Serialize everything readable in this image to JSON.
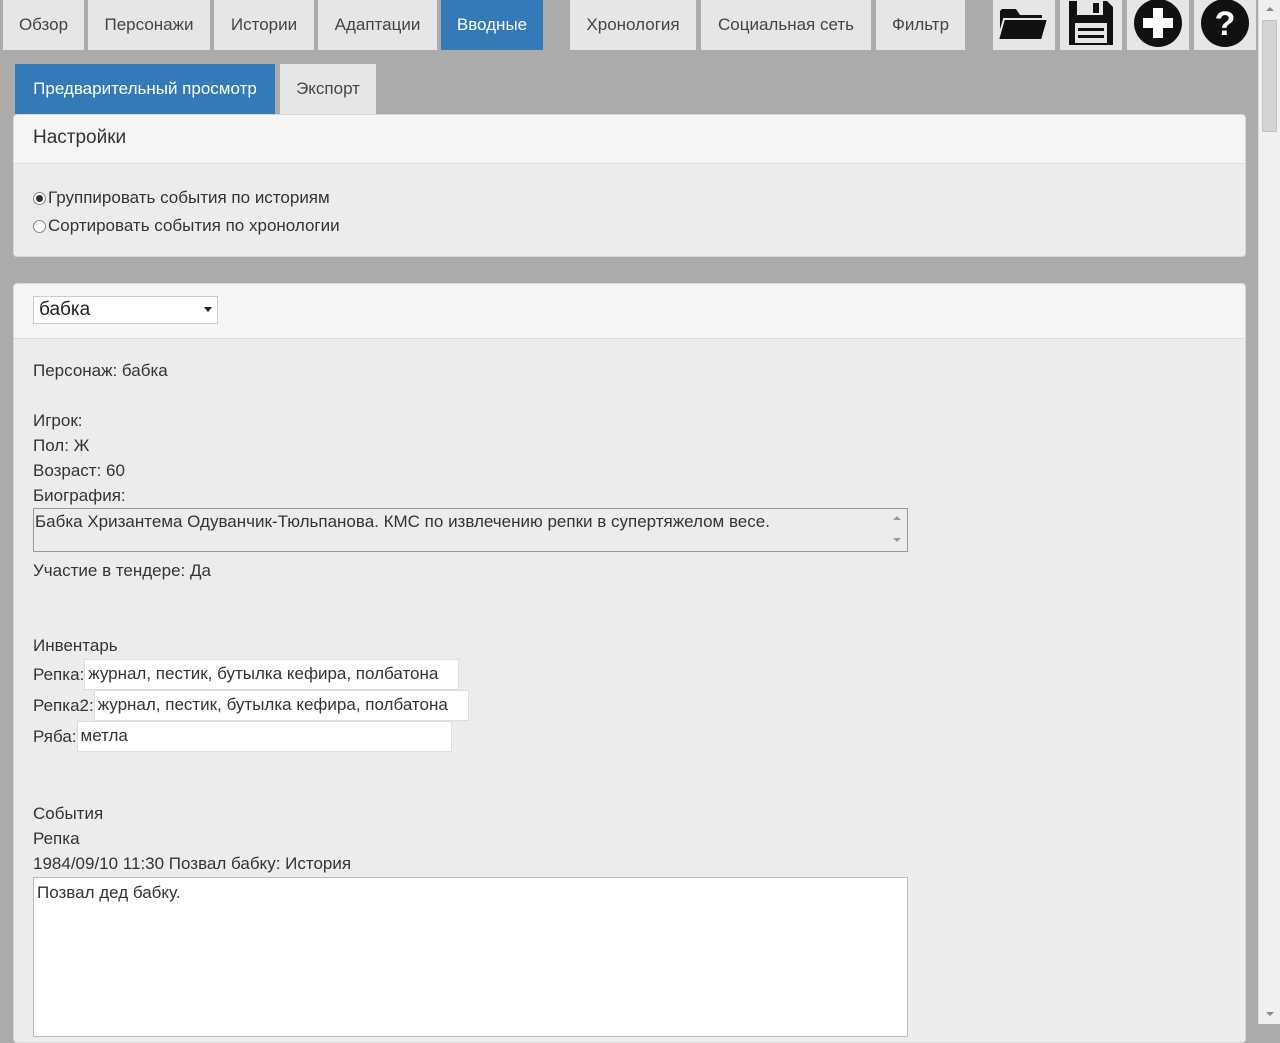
{
  "nav": {
    "tabs": [
      {
        "label": "Обзор"
      },
      {
        "label": "Персонажи"
      },
      {
        "label": "Истории"
      },
      {
        "label": "Адаптации"
      },
      {
        "label": "Вводные"
      },
      {
        "label": "Хронология"
      },
      {
        "label": "Социальная сеть"
      },
      {
        "label": "Фильтр"
      }
    ],
    "icons": [
      "open-folder-icon",
      "save-icon",
      "add-icon",
      "help-icon"
    ]
  },
  "subtabs": [
    {
      "label": "Предварительный просмотр"
    },
    {
      "label": "Экспорт"
    }
  ],
  "settings": {
    "title": "Настройки",
    "options": [
      {
        "label": "Группировать события по историям",
        "checked": true
      },
      {
        "label": "Сортировать события по хронологии",
        "checked": false
      }
    ]
  },
  "character": {
    "selected": "бабка",
    "name_line": "Персонаж: бабка",
    "player_line": "Игрок:",
    "gender_line": "Пол: Ж",
    "age_line": "Возраст: 60",
    "bio_label": "Биография:",
    "bio_text": "Бабка Хризантема Одуванчик-Тюльпанова. КМС по извлечению репки в супертяжелом весе.",
    "tender_line": "Участие в тендере: Да",
    "inventory_title": "Инвентарь",
    "inventory": [
      {
        "label": "Репка:",
        "value": "журнал, пестик, бутылка кефира, полбатона"
      },
      {
        "label": "Репка2:",
        "value": "журнал, пестик, бутылка кефира, полбатона"
      },
      {
        "label": "Ряба:",
        "value": "метла"
      }
    ],
    "events_title": "События",
    "event_story": "Репка",
    "event_header": "1984/09/10 11:30 Позвал бабку: История",
    "event_text": "Позвал дед бабку."
  }
}
